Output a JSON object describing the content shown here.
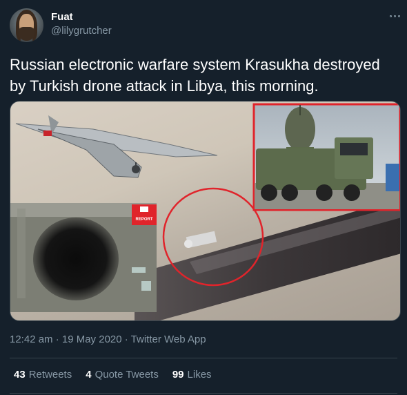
{
  "author": {
    "name": "Fuat",
    "handle": "@lilygrutcher"
  },
  "tweet": {
    "text": "Russian electronic warfare system Krasukha destroyed by Turkish drone attack in Libya, this morning."
  },
  "media": {
    "overlay_badge": "REPORT"
  },
  "meta": {
    "timestamp": "12:42 am · 19 May 2020 · Twitter Web App"
  },
  "stats": {
    "retweets_count": "43",
    "retweets_label": "Retweets",
    "quotes_count": "4",
    "quotes_label": "Quote Tweets",
    "likes_count": "99",
    "likes_label": "Likes"
  },
  "colors": {
    "background": "#15202b",
    "secondary_text": "#8899a6",
    "divider": "#38444d",
    "highlight_red": "#e0242b"
  },
  "icons": {
    "more": "more-options-icon"
  }
}
